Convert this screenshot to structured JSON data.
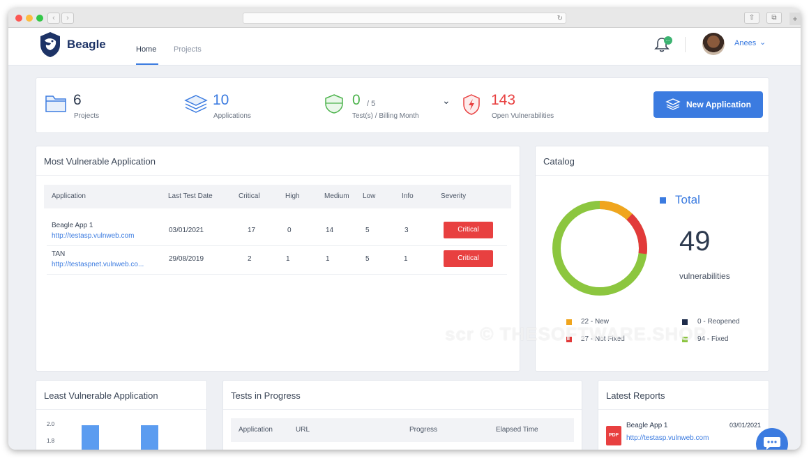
{
  "app": {
    "brand": "Beagle"
  },
  "nav": {
    "home": "Home",
    "projects": "Projects"
  },
  "user": {
    "name": "Anees"
  },
  "notifications": {
    "badge": "…"
  },
  "stats": {
    "projects": {
      "value": "6",
      "label": "Projects"
    },
    "applications": {
      "value": "10",
      "label": "Applications"
    },
    "tests": {
      "value": "0",
      "of": "/ 5",
      "label": "Test(s) / Billing Month"
    },
    "vulnerabilities": {
      "value": "143",
      "label": "Open Vulnerabilities"
    }
  },
  "new_application_button": "New Application",
  "most_vulnerable": {
    "title": "Most Vulnerable Application",
    "columns": [
      "Application",
      "Last Test Date",
      "Critical",
      "High",
      "Medium",
      "Low",
      "Info",
      "Severity"
    ],
    "rows": [
      {
        "name": "Beagle App 1",
        "url": "http://testasp.vulnweb.com",
        "date": "03/01/2021",
        "critical": "17",
        "high": "0",
        "medium": "14",
        "low": "5",
        "info": "3",
        "severity": "Critical"
      },
      {
        "name": "TAN",
        "url": "http://testaspnet.vulnweb.co...",
        "date": "29/08/2019",
        "critical": "2",
        "high": "1",
        "medium": "1",
        "low": "5",
        "info": "1",
        "severity": "Critical"
      }
    ]
  },
  "catalog": {
    "title": "Catalog",
    "total_label": "Total",
    "total_value": "49",
    "total_unit": "vulnerabilities",
    "legend": [
      {
        "label": "22 - New",
        "color": "#f0a51e"
      },
      {
        "label": "0 - Reopened",
        "color": "#1d2b4a"
      },
      {
        "label": "27 - Not Fixed",
        "color": "#e23a3a"
      },
      {
        "label": "94 - Fixed",
        "color": "#8cc63f"
      }
    ],
    "donut": {
      "new_fraction": 0.12,
      "notfixed_fraction": 0.15,
      "fixed_fraction": 0.73
    }
  },
  "least_vulnerable": {
    "title": "Least Vulnerable Application",
    "ticks": [
      "2.0",
      "1.8"
    ]
  },
  "tests_in_progress": {
    "title": "Tests in Progress",
    "columns": [
      "Application",
      "URL",
      "Progress",
      "Elapsed Time"
    ]
  },
  "latest_reports": {
    "title": "Latest Reports",
    "item": {
      "name": "Beagle App 1",
      "url": "http://testasp.vulnweb.com",
      "date": "03/01/2021",
      "file_type": "PDF"
    }
  },
  "watermark": "scr © THESOFTWARE.SHOP",
  "colors": {
    "accent": "#3b7be0",
    "critical": "#e84040",
    "brand": "#1d3366"
  }
}
